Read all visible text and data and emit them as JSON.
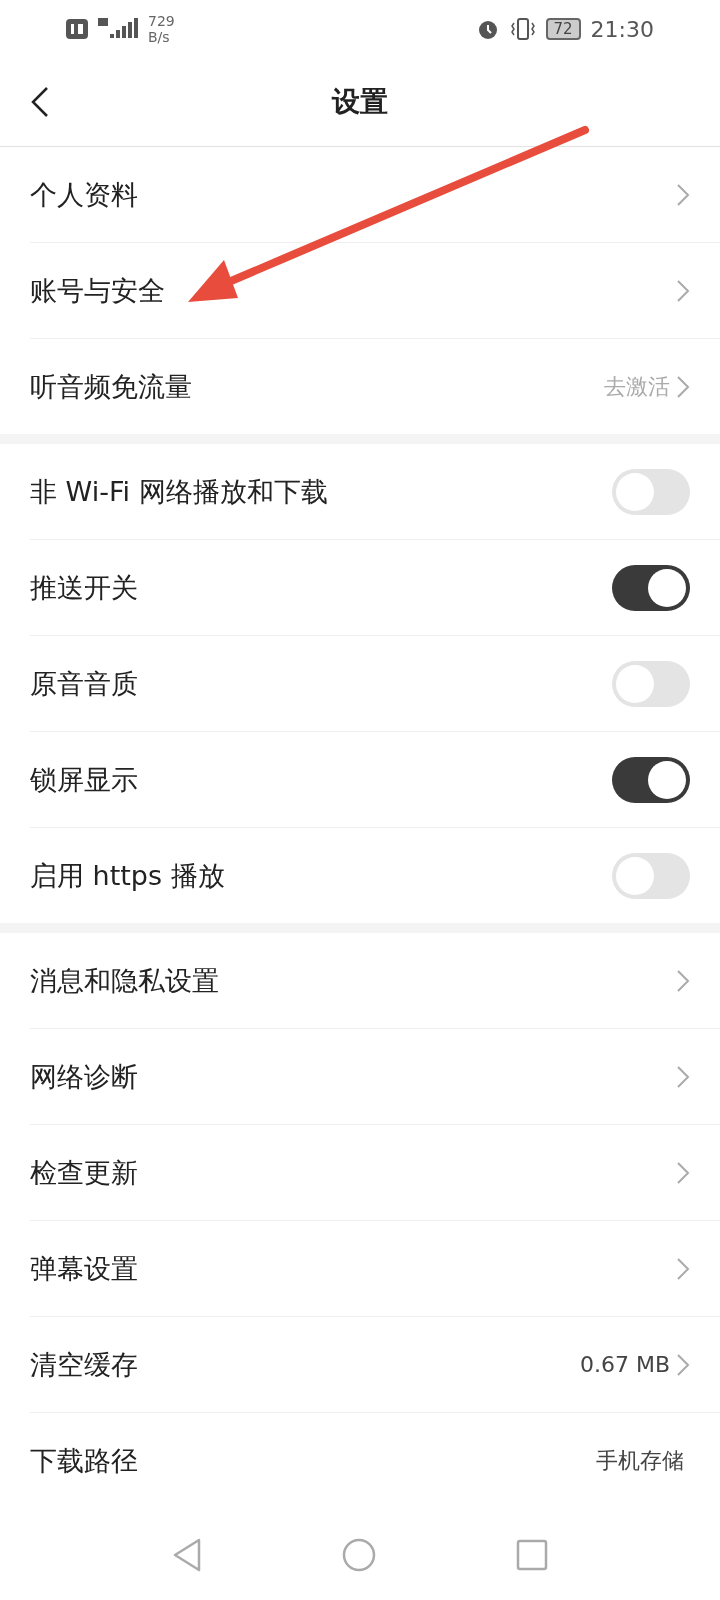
{
  "status_bar": {
    "speed_value": "729",
    "speed_unit": "B/s",
    "battery": "72",
    "time": "21:30"
  },
  "header": {
    "title": "设置"
  },
  "sections": [
    {
      "rows": [
        {
          "kind": "link",
          "label": "个人资料"
        },
        {
          "kind": "link",
          "label": "账号与安全"
        },
        {
          "kind": "link",
          "label": "听音频免流量",
          "value": "去激活",
          "value_muted": true
        }
      ]
    },
    {
      "rows": [
        {
          "kind": "toggle",
          "label": "非 Wi-Fi 网络播放和下载",
          "on": false
        },
        {
          "kind": "toggle",
          "label": "推送开关",
          "on": true
        },
        {
          "kind": "toggle",
          "label": "原音音质",
          "on": false
        },
        {
          "kind": "toggle",
          "label": "锁屏显示",
          "on": true
        },
        {
          "kind": "toggle",
          "label": "启用 https 播放",
          "on": false
        }
      ]
    },
    {
      "rows": [
        {
          "kind": "link",
          "label": "消息和隐私设置"
        },
        {
          "kind": "link",
          "label": "网络诊断"
        },
        {
          "kind": "link",
          "label": "检查更新"
        },
        {
          "kind": "link",
          "label": "弹幕设置"
        },
        {
          "kind": "link",
          "label": "清空缓存",
          "value": "0.67 MB",
          "value_muted": false
        },
        {
          "kind": "info",
          "label": "下载路径",
          "value": "手机存储",
          "value_muted": false
        }
      ]
    }
  ]
}
